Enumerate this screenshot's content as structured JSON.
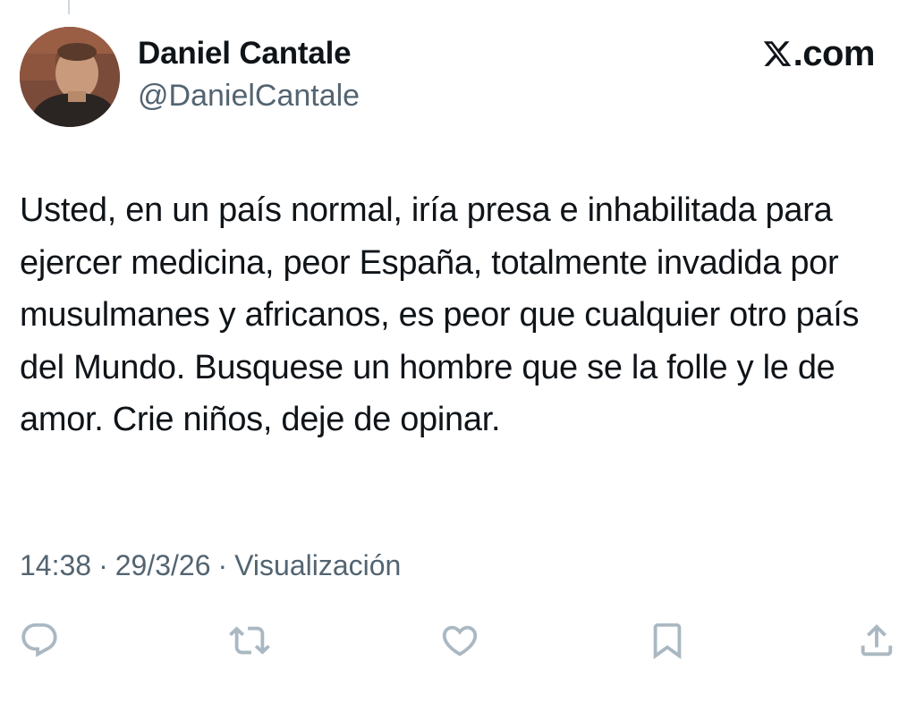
{
  "author": {
    "name": "Daniel Cantale",
    "handle": "@DanielCantale"
  },
  "brand": {
    "logo_icon": "x-logo-icon",
    "text": ".com"
  },
  "tweet": {
    "text": "Usted, en un país normal, iría presa e inhabilitada para ejercer medicina, peor España, totalmente invadida por musulmanes y africanos, es peor que cualquier otro país del Mundo. Busquese un hombre que se la folle y le de amor. Crie niños, deje de opinar.",
    "time": "14:38",
    "separator": "·",
    "date": "29/3/26",
    "views_label": "Visualización"
  },
  "actions": [
    {
      "icon": "reply-icon"
    },
    {
      "icon": "repost-icon"
    },
    {
      "icon": "like-icon"
    },
    {
      "icon": "bookmark-icon"
    },
    {
      "icon": "share-icon"
    }
  ],
  "colors": {
    "text_primary": "#0f1419",
    "text_secondary": "#536471",
    "icon_muted": "#aab8c2",
    "thread_line": "#cfd9de",
    "background": "#ffffff"
  }
}
